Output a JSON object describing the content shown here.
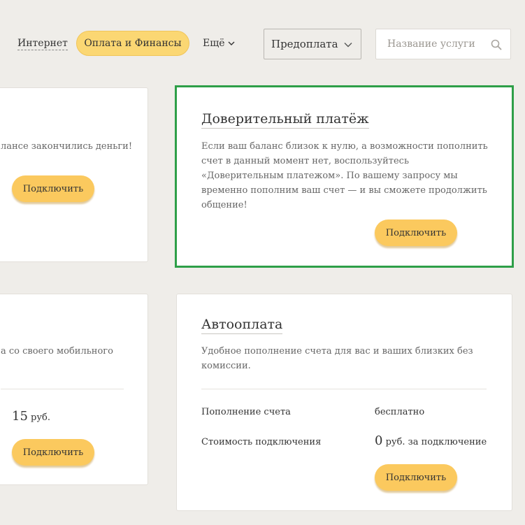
{
  "nav": {
    "internet": "Интернет",
    "payments": "Оплата и Финансы",
    "more": "Ещё"
  },
  "filter": {
    "selected": "Предоплата"
  },
  "search": {
    "placeholder": "Название услуги"
  },
  "cards": {
    "left_top": {
      "desc": "лансе закончились деньги!",
      "button": "Подключить"
    },
    "trust_payment": {
      "title": "Доверительный платёж",
      "desc": "Если ваш баланс близок к нулю, а возможности пополнить счет в данный момент нет, воспользуйтесь «Доверительным платежом». По вашему запросу мы временно пополним ваш счет — и вы сможете продолжить общение!",
      "button": "Подключить"
    },
    "left_bottom": {
      "desc": "а со своего мобильного",
      "price_value": "15",
      "price_unit": "руб.",
      "button": "Подключить"
    },
    "autopay": {
      "title": "Автооплата",
      "desc": "Удобное пополнение счета для вас и ваших близких без комиссии.",
      "rows": [
        {
          "label": "Пополнение счета",
          "value": "бесплатно"
        },
        {
          "label": "Стоимость подключения",
          "value_num": "0",
          "value_unit": "руб. за подключение"
        }
      ],
      "button": "Подключить"
    }
  },
  "colors": {
    "accent": "#fbc95e",
    "highlight": "#2e9f48",
    "background": "#efede9"
  }
}
